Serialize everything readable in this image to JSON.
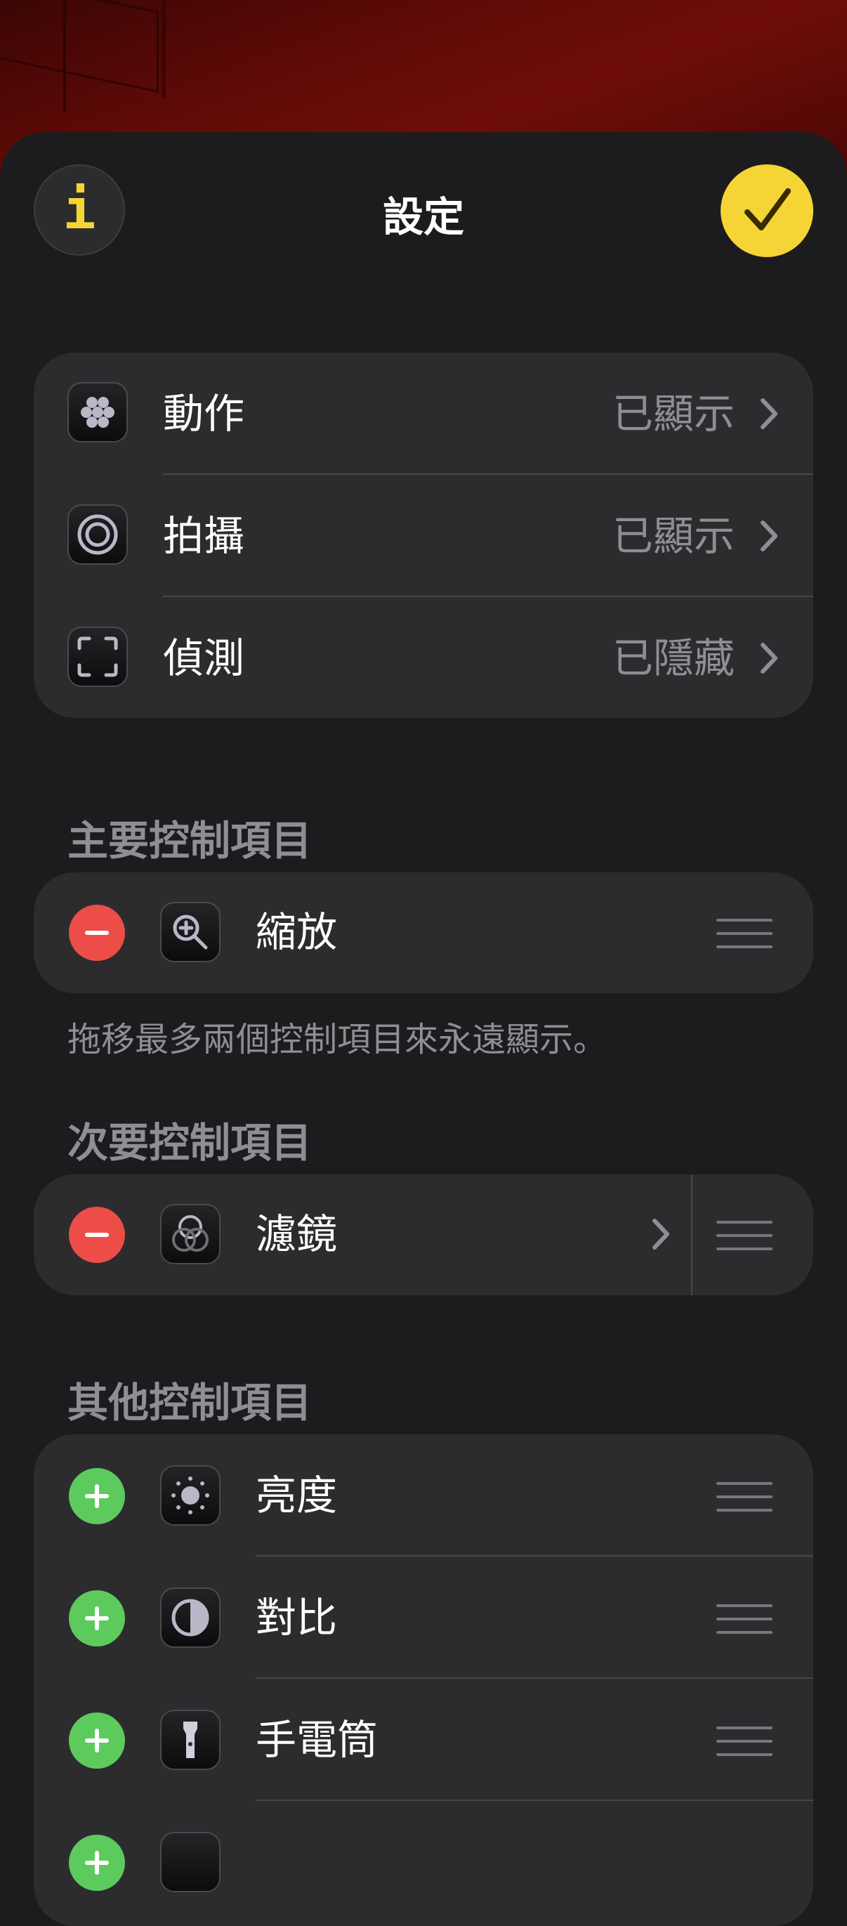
{
  "header": {
    "title": "設定",
    "info_label": "i"
  },
  "modes": [
    {
      "label": "動作",
      "status": "已顯示"
    },
    {
      "label": "拍攝",
      "status": "已顯示"
    },
    {
      "label": "偵測",
      "status": "已隱藏"
    }
  ],
  "primary": {
    "header": "主要控制項目",
    "items": [
      {
        "label": "縮放"
      }
    ],
    "footnote": "拖移最多兩個控制項目來永遠顯示。"
  },
  "secondary": {
    "header": "次要控制項目",
    "items": [
      {
        "label": "濾鏡"
      }
    ]
  },
  "other": {
    "header": "其他控制項目",
    "items": [
      {
        "label": "亮度"
      },
      {
        "label": "對比"
      },
      {
        "label": "手電筒"
      }
    ]
  },
  "colors": {
    "accent": "#f5d535",
    "remove": "#ec4e47",
    "add": "#5dca5e",
    "background": "#1c1c1e",
    "card": "#2c2c2e"
  }
}
